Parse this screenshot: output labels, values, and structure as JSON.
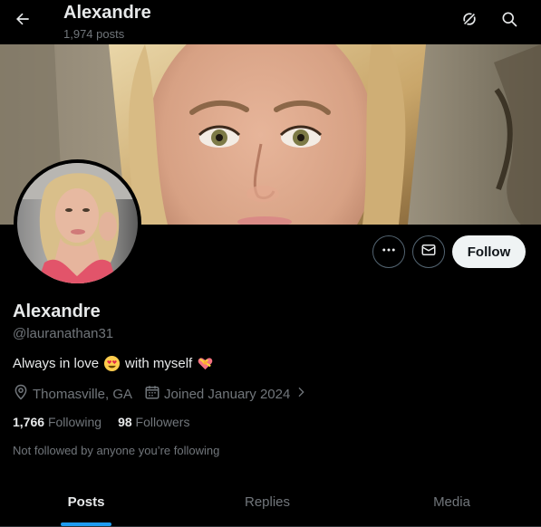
{
  "colors": {
    "background": "#000000",
    "text_primary": "#e7e9ea",
    "text_secondary": "#71767b",
    "accent": "#1d9bf0",
    "button_light": "#eff3f4"
  },
  "header": {
    "title": "Alexandre",
    "subtitle": "1,974 posts",
    "icons": [
      "arrow-left-icon",
      "grok-icon",
      "search-icon"
    ]
  },
  "actions": {
    "follow_label": "Follow",
    "icons": [
      "more-icon",
      "envelope-icon"
    ]
  },
  "profile": {
    "name": "Alexandre",
    "handle": "@lauranathan31",
    "bio_part1": "Always in love",
    "bio_part2": "with myself",
    "bio_emojis": [
      "😍",
      "💝"
    ],
    "location": "Thomasville, GA",
    "joined": "Joined January 2024",
    "following_count": "1,766",
    "following_label": "Following",
    "followers_count": "98",
    "followers_label": "Followers",
    "not_followed_text": "Not followed by anyone you’re following"
  },
  "tabs": [
    {
      "label": "Posts",
      "active": true
    },
    {
      "label": "Replies",
      "active": false
    },
    {
      "label": "Media",
      "active": false
    }
  ]
}
